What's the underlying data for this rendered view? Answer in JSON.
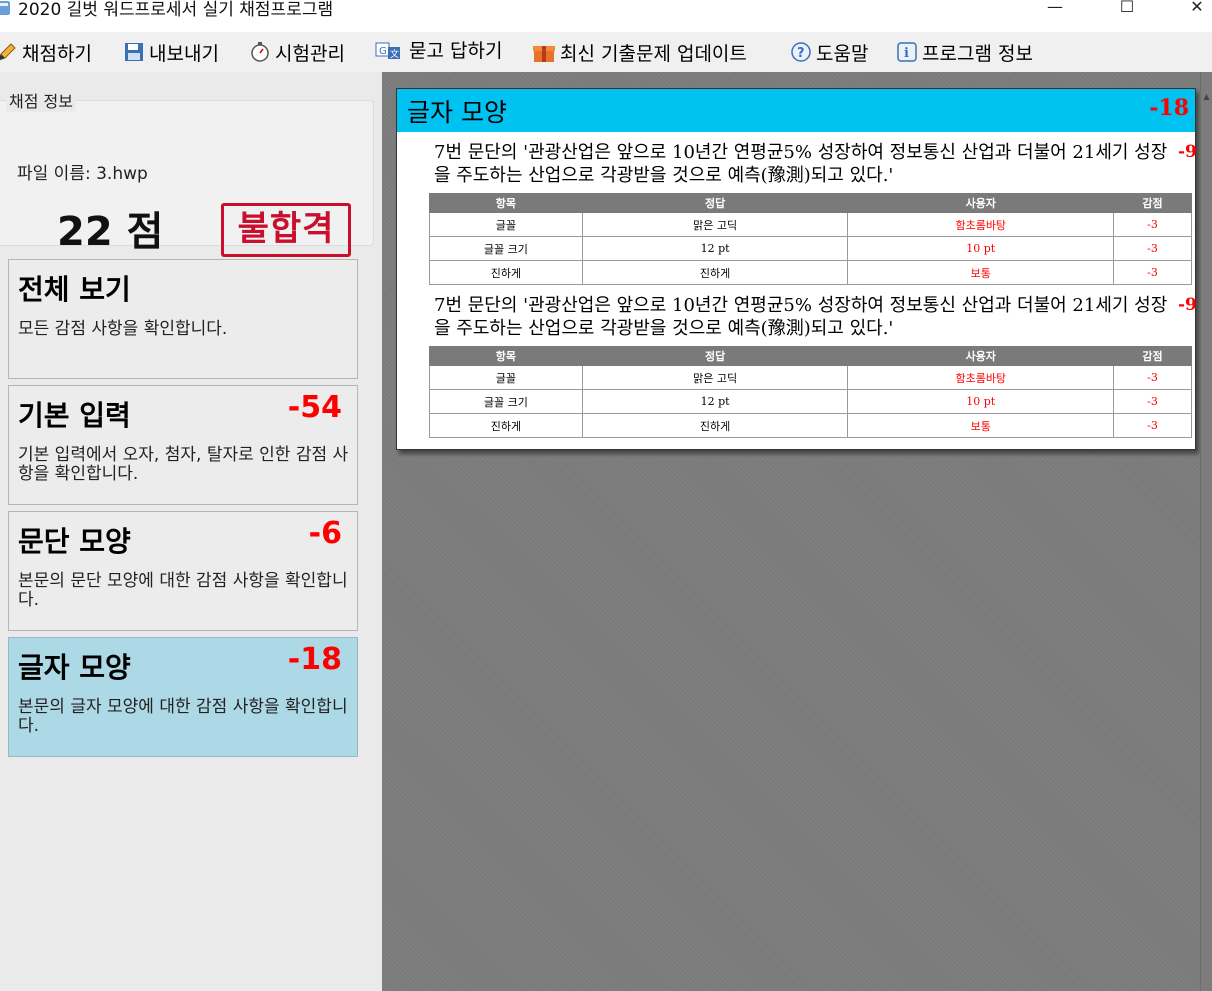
{
  "window": {
    "title": "2020 길벗 워드프로세서 실기 채점프로그램",
    "minimize": "—",
    "maximize": "☐",
    "close": "✕"
  },
  "menu": [
    {
      "label": "채점하기",
      "icon": "pencil-icon"
    },
    {
      "label": "내보내기",
      "icon": "floppy-disk-icon"
    },
    {
      "label": "시험관리",
      "icon": "stopwatch-icon"
    },
    {
      "label": "묻고 답하기",
      "icon": "translate-icon"
    },
    {
      "label": "최신 기출문제 업데이트",
      "icon": "gift-icon"
    },
    {
      "label": "도움말",
      "icon": "help-icon"
    },
    {
      "label": "프로그램 정보",
      "icon": "info-icon"
    }
  ],
  "info": {
    "legend": "채점 정보",
    "file_name": "파일 이름: 3.hwp",
    "score": "22 점",
    "result_stamp": "불합격"
  },
  "categories": [
    {
      "title": "전체 보기",
      "deduction": "",
      "desc": "모든 감점 사항을 확인합니다."
    },
    {
      "title": "기본 입력",
      "deduction": "-54",
      "desc": "기본 입력에서 오자, 첨자, 탈자로 인한 감점 사항을 확인합니다."
    },
    {
      "title": "문단 모양",
      "deduction": "-6",
      "desc": "본문의 문단 모양에 대한 감점 사항을 확인합니다."
    },
    {
      "title": "글자 모양",
      "deduction": "-18",
      "desc": "본문의 글자 모양에 대한 감점 사항을 확인합니다."
    }
  ],
  "report": {
    "title": "글자 모양",
    "deduction": "-18",
    "headers": [
      "항목",
      "정답",
      "사용자",
      "감점"
    ],
    "sections": [
      {
        "paragraph": "7번 문단의 '관광산업은 앞으로 10년간 연평균5% 성장하여 정보통신 산업과 더불어 21세기 성장을 주도하는 산업으로 각광받을 것으로 예측(豫測)되고 있다.'",
        "deduction": "-9",
        "rows": [
          {
            "item": "글꼴",
            "answer": "맑은 고딕",
            "user": "함초롬바탕",
            "deduct": "-3"
          },
          {
            "item": "글꼴 크기",
            "answer": "12 pt",
            "user": "10 pt",
            "deduct": "-3"
          },
          {
            "item": "진하게",
            "answer": "진하게",
            "user": "보통",
            "deduct": "-3"
          }
        ]
      },
      {
        "paragraph": "7번 문단의 '관광산업은 앞으로 10년간 연평균5% 성장하여 정보통신 산업과 더불어 21세기 성장을 주도하는 산업으로 각광받을 것으로 예측(豫測)되고 있다.'",
        "deduction": "-9",
        "rows": [
          {
            "item": "글꼴",
            "answer": "맑은 고딕",
            "user": "함초롬바탕",
            "deduct": "-3"
          },
          {
            "item": "글꼴 크기",
            "answer": "12 pt",
            "user": "10 pt",
            "deduct": "-3"
          },
          {
            "item": "진하게",
            "answer": "진하게",
            "user": "보통",
            "deduct": "-3"
          }
        ]
      }
    ]
  },
  "colors": {
    "accent_header": "#00c2f0",
    "deduction_red": "#ff0000",
    "active_card": "#add8e6",
    "stamp_red": "#c8102e"
  }
}
